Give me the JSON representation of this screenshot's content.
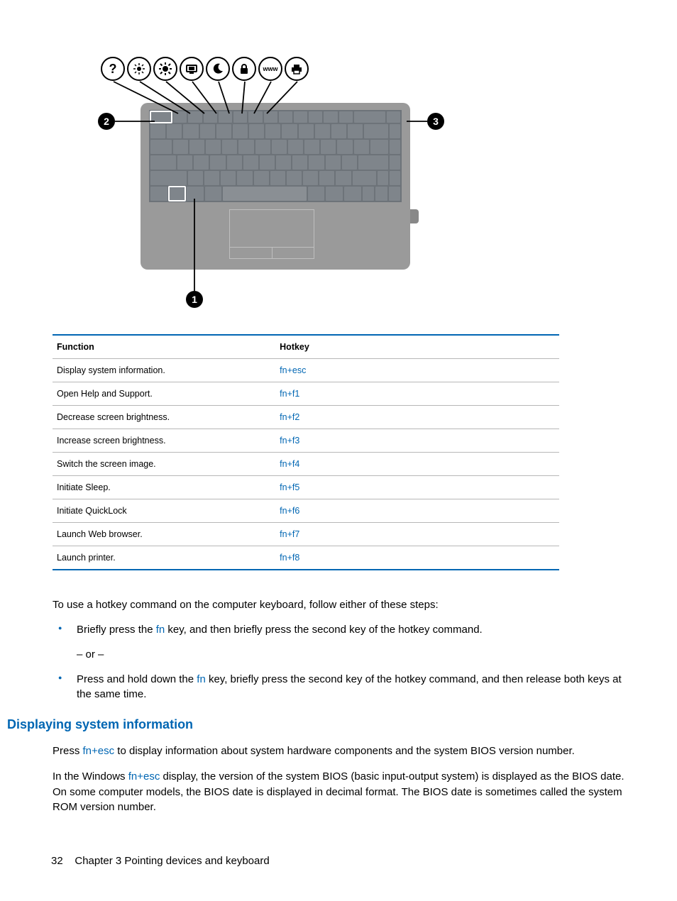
{
  "diagram": {
    "callouts": {
      "c1": "1",
      "c2": "2",
      "c3": "3"
    },
    "icons": [
      "help",
      "brightness-down",
      "brightness-up",
      "display-switch",
      "sleep",
      "lock",
      "www",
      "printer"
    ],
    "www_label": "www"
  },
  "table": {
    "head": {
      "function": "Function",
      "hotkey": "Hotkey"
    },
    "rows": [
      {
        "f": "Display system information.",
        "k": "fn+esc"
      },
      {
        "f": "Open Help and Support.",
        "k": "fn+f1"
      },
      {
        "f": "Decrease screen brightness.",
        "k": "fn+f2"
      },
      {
        "f": "Increase screen brightness.",
        "k": "fn+f3"
      },
      {
        "f": "Switch the screen image.",
        "k": "fn+f4"
      },
      {
        "f": "Initiate Sleep.",
        "k": "fn+f5"
      },
      {
        "f": "Initiate QuickLock",
        "k": "fn+f6"
      },
      {
        "f": "Launch Web browser.",
        "k": "fn+f7"
      },
      {
        "f": "Launch printer.",
        "k": "fn+f8"
      }
    ]
  },
  "intro": "To use a hotkey command on the computer keyboard, follow either of these steps:",
  "bullet1_pre": "Briefly press the ",
  "bullet1_kw": "fn",
  "bullet1_post": " key, and then briefly press the second key of the hotkey command.",
  "or_text": "– or –",
  "bullet2_pre": "Press and hold down the ",
  "bullet2_kw": "fn",
  "bullet2_post": " key, briefly press the second key of the hotkey command, and then release both keys at the same time.",
  "section_heading": "Displaying system information",
  "sys_p1_pre": "Press ",
  "sys_p1_kw": "fn+esc",
  "sys_p1_post": " to display information about system hardware components and the system BIOS version number.",
  "sys_p2_pre": "In the Windows ",
  "sys_p2_kw": "fn+esc",
  "sys_p2_post": " display, the version of the system BIOS (basic input-output system) is displayed as the BIOS date. On some computer models, the BIOS date is displayed in decimal format. The BIOS date is sometimes called the system ROM version number.",
  "footer": {
    "page": "32",
    "chapter": "Chapter 3   Pointing devices and keyboard"
  }
}
